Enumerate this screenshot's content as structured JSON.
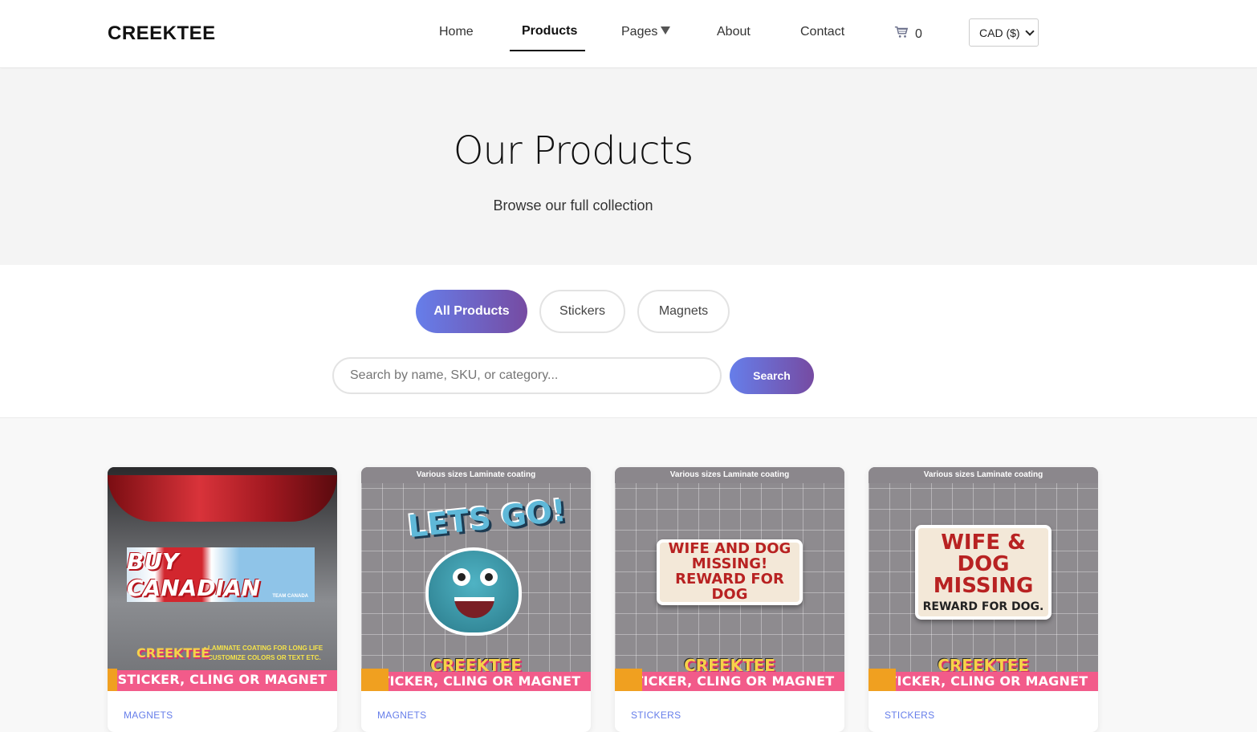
{
  "header": {
    "logo": "CREEKTEE",
    "nav": {
      "home": "Home",
      "products": "Products",
      "pages": "Pages",
      "about": "About",
      "contact": "Contact"
    },
    "cart_count": "0",
    "currency": "CAD ($)"
  },
  "hero": {
    "title": "Our Products",
    "subtitle": "Browse our full collection"
  },
  "filters": {
    "all": "All Products",
    "stickers": "Stickers",
    "magnets": "Magnets"
  },
  "search": {
    "placeholder": "Search by name, SKU, or category...",
    "button": "Search"
  },
  "products": [
    {
      "category": "MAGNETS",
      "image_text": "BUY CANADIAN",
      "image_sub": "TEAM CANADA",
      "image_features": [
        "• LAMINATE COATING FOR LONG LIFE",
        "• CUSTOMIZE COLORS OR TEXT ETC."
      ],
      "band": "STICKER, CLING OR MAGNET",
      "brand": "CREEKTEE"
    },
    {
      "category": "MAGNETS",
      "top_text": "Various sizes Laminate coating",
      "image_text": "LETS GO!",
      "band": "STICKER, CLING OR MAGNET",
      "brand": "CREEKTEE"
    },
    {
      "category": "STICKERS",
      "top_text": "Various sizes Laminate coating",
      "image_text": "WIFE AND DOG MISSING! REWARD FOR DOG",
      "band": "STICKER, CLING OR MAGNET",
      "brand": "CREEKTEE"
    },
    {
      "category": "STICKERS",
      "top_text": "Various sizes Laminate coating",
      "image_text": "WIFE & DOG MISSING",
      "image_sub": "REWARD FOR DOG.",
      "band": "STICKER, CLING OR MAGNET",
      "brand": "CREEKTEE"
    }
  ],
  "colors": {
    "accent_start": "#667eea",
    "accent_end": "#764ba2",
    "band_pink": "#f25b8a"
  }
}
